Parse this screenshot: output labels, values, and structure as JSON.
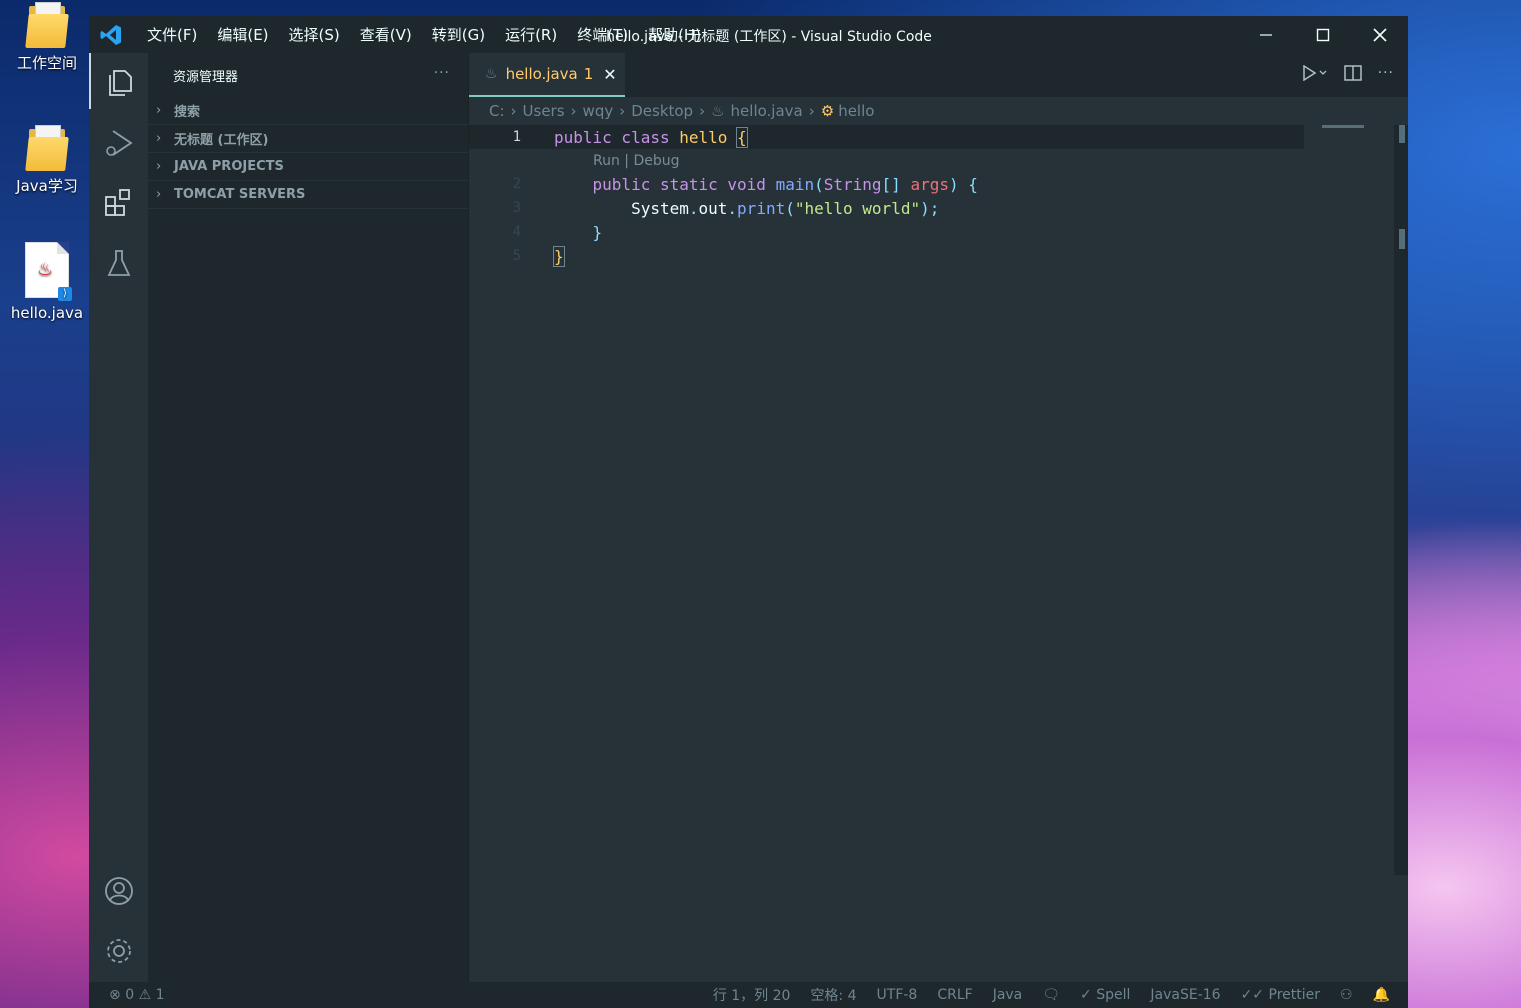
{
  "desktop": {
    "icons": [
      {
        "label": "工作空间",
        "icon": "folder-icon"
      },
      {
        "label": "Java学习",
        "icon": "folder-icon"
      },
      {
        "label": "hello.java",
        "icon": "java-file-icon"
      }
    ]
  },
  "titlebar": {
    "menu": [
      "文件(F)",
      "编辑(E)",
      "选择(S)",
      "查看(V)",
      "转到(G)",
      "运行(R)",
      "终端(T)",
      "帮助(H)"
    ],
    "title": "hello.java - 无标题 (工作区) - Visual Studio Code"
  },
  "sidebar": {
    "title": "资源管理器",
    "more": "···",
    "sections": [
      "搜索",
      "无标题 (工作区)",
      "JAVA PROJECTS",
      "TOMCAT SERVERS"
    ]
  },
  "tab": {
    "name": "hello.java",
    "problems": "1",
    "close": "✕"
  },
  "breadcrumb": [
    "C:",
    "Users",
    "wqy",
    "Desktop",
    "hello.java",
    "hello"
  ],
  "code": {
    "codelens": "Run | Debug",
    "line_numbers": [
      "1",
      "2",
      "3",
      "4",
      "5"
    ]
  },
  "statusbar": {
    "errors": "0",
    "warnings": "1",
    "position": "行 1，列 20",
    "indent": "空格: 4",
    "encoding": "UTF-8",
    "eol": "CRLF",
    "language": "Java",
    "spell": "Spell",
    "jdk": "JavaSE-16",
    "prettier": "Prettier"
  },
  "colors": {
    "accent": "#80cbc4",
    "background": "#263238",
    "sidebar": "#1e272c",
    "tab_text": "#ffcb6b"
  }
}
